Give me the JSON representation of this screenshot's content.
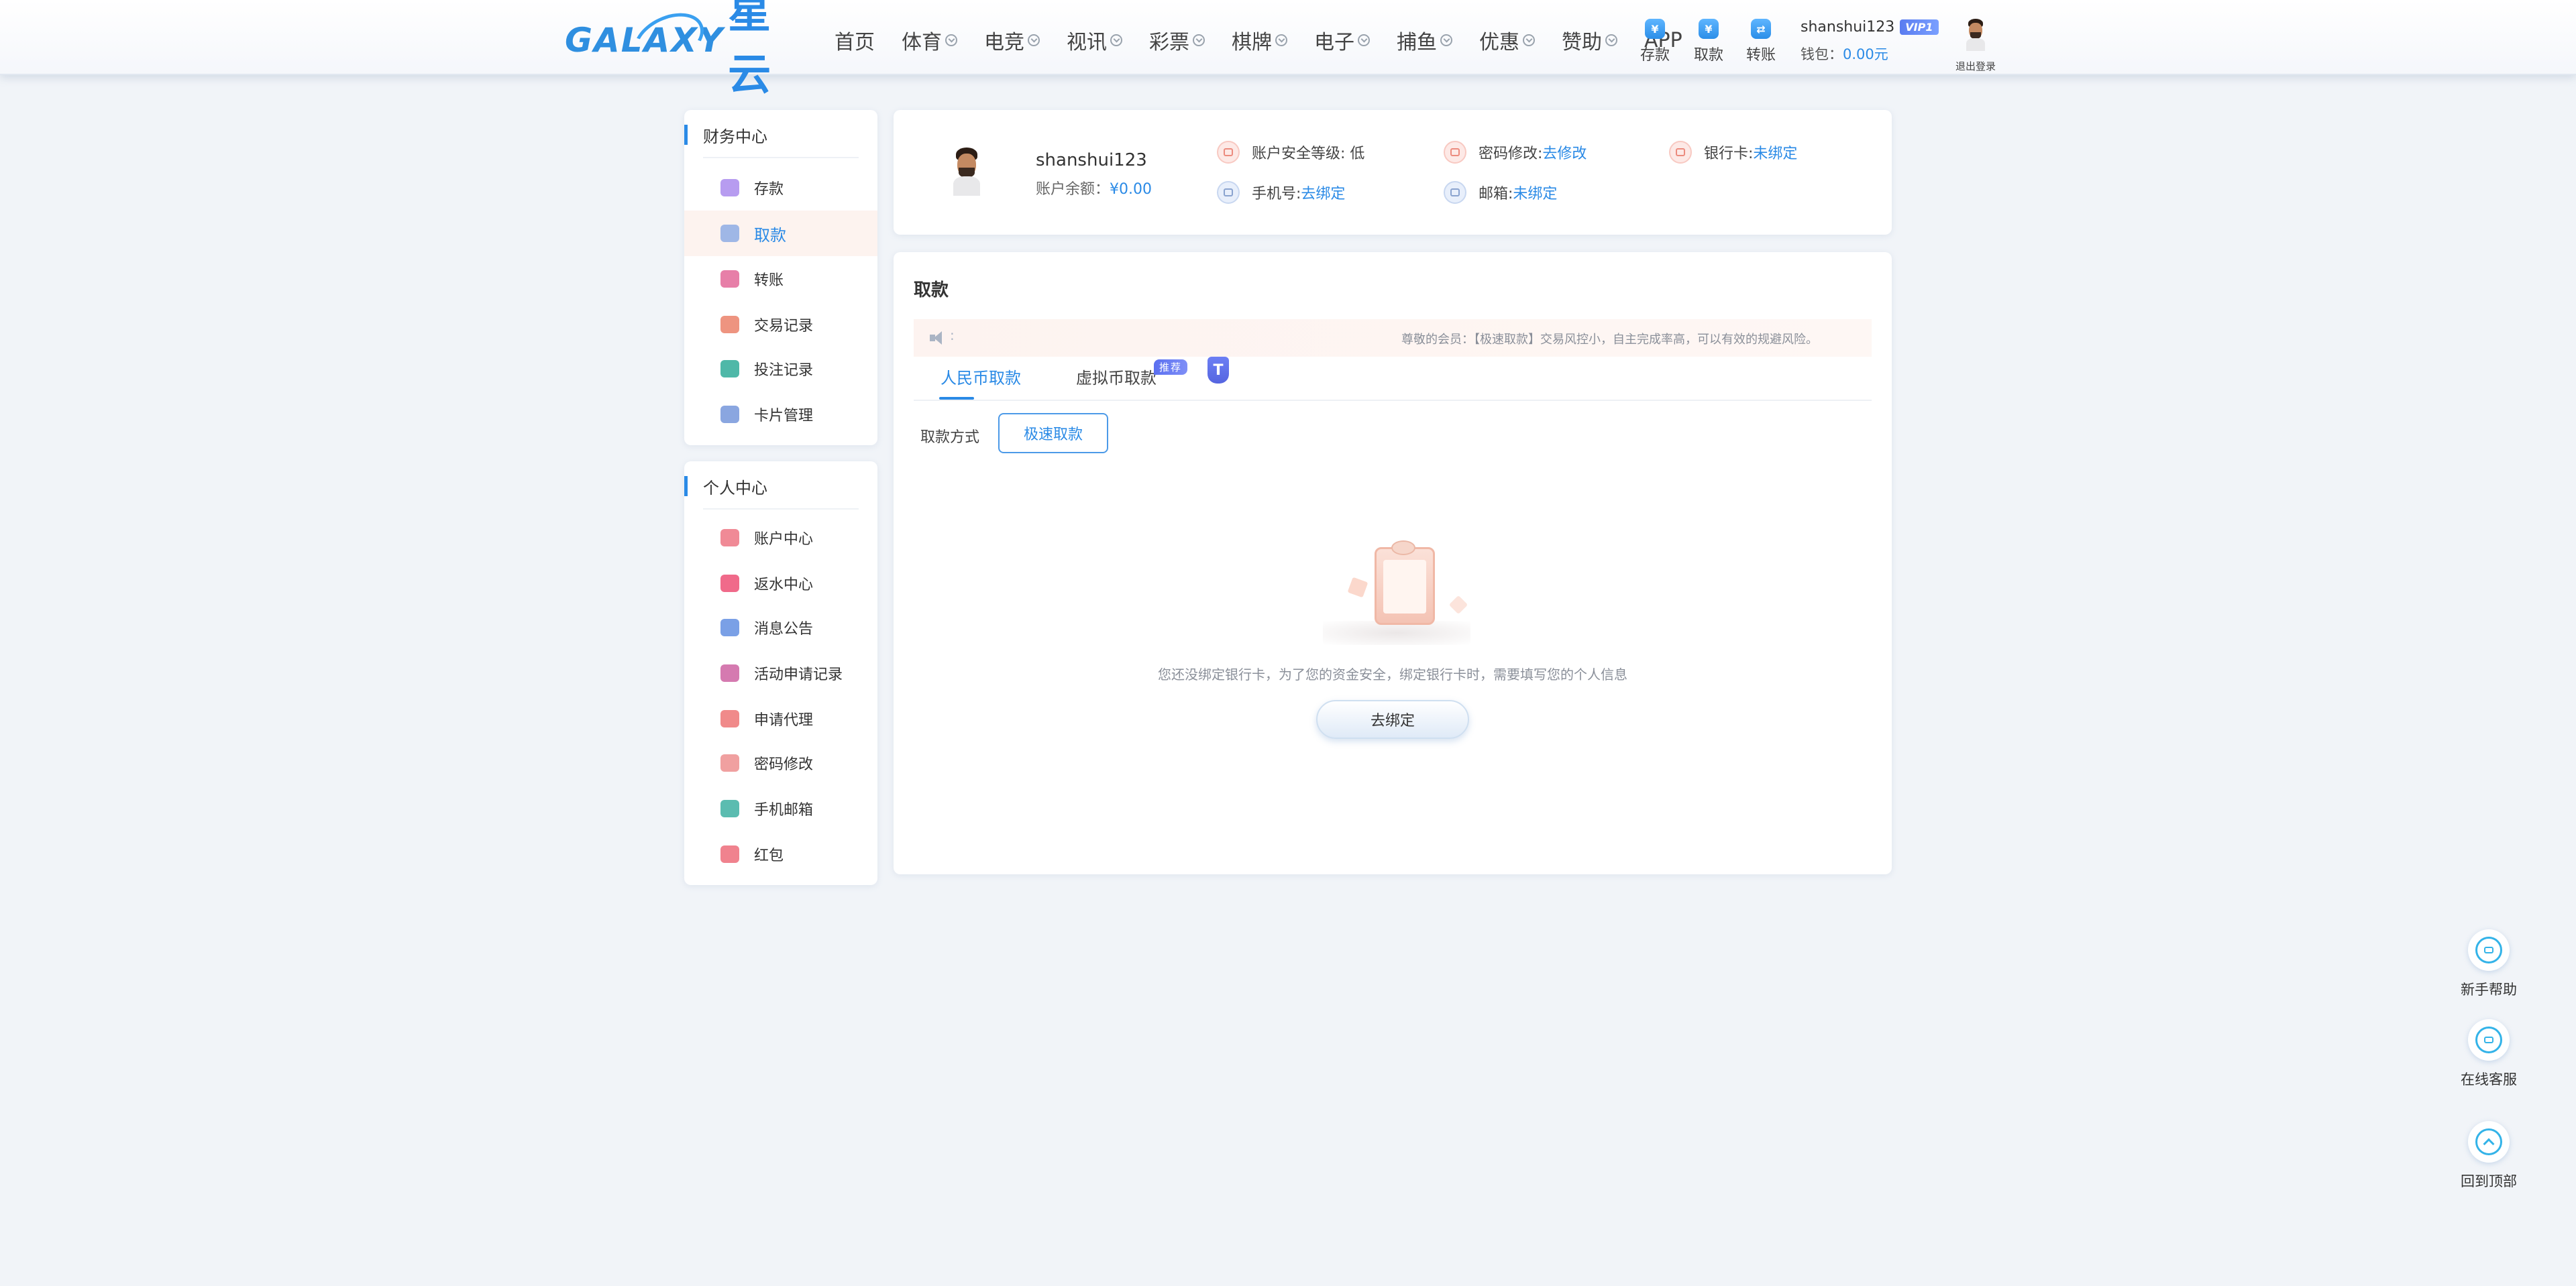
{
  "header": {
    "logo_text": "GALAXY",
    "logo_cn": "星云",
    "nav": [
      {
        "label": "首页",
        "dropdown": false
      },
      {
        "label": "体育",
        "dropdown": true
      },
      {
        "label": "电竞",
        "dropdown": true
      },
      {
        "label": "视讯",
        "dropdown": true
      },
      {
        "label": "彩票",
        "dropdown": true
      },
      {
        "label": "棋牌",
        "dropdown": true
      },
      {
        "label": "电子",
        "dropdown": true
      },
      {
        "label": "捕鱼",
        "dropdown": true
      },
      {
        "label": "优惠",
        "dropdown": true
      },
      {
        "label": "赞助",
        "dropdown": true
      },
      {
        "label": "APP",
        "dropdown": false
      }
    ],
    "quick_actions": [
      {
        "label": "存款",
        "icon": "deposit-icon"
      },
      {
        "label": "取款",
        "icon": "withdraw-icon"
      },
      {
        "label": "转账",
        "icon": "transfer-icon"
      }
    ],
    "username": "shanshui123",
    "vip": "VIP1",
    "wallet_label": "钱包：",
    "wallet_value": "0.00元",
    "logout_label": "退出登录"
  },
  "sidebar": {
    "finance": {
      "title": "财务中心",
      "items": [
        {
          "label": "存款",
          "icon": "deposit-icon",
          "color": "#b79cf0",
          "active": false
        },
        {
          "label": "取款",
          "icon": "wallet-icon",
          "color": "#9fb7e6",
          "active": true
        },
        {
          "label": "转账",
          "icon": "transfer-icon",
          "color": "#e77fa8",
          "active": false
        },
        {
          "label": "交易记录",
          "icon": "transaction-record-icon",
          "color": "#ee9480",
          "active": false
        },
        {
          "label": "投注记录",
          "icon": "bet-record-icon",
          "color": "#4fb8a8",
          "active": false
        },
        {
          "label": "卡片管理",
          "icon": "card-icon",
          "color": "#8aa6e0",
          "active": false
        }
      ]
    },
    "personal": {
      "title": "个人中心",
      "items": [
        {
          "label": "账户中心",
          "icon": "heart-icon",
          "color": "#f08a96"
        },
        {
          "label": "返水中心",
          "icon": "gift-icon",
          "color": "#f06a8a"
        },
        {
          "label": "消息公告",
          "icon": "bell-icon",
          "color": "#7aa0e6"
        },
        {
          "label": "活动申请记录",
          "icon": "user-card-icon",
          "color": "#d57ab0"
        },
        {
          "label": "申请代理",
          "icon": "agent-icon",
          "color": "#f08a8a"
        },
        {
          "label": "密码修改",
          "icon": "lock-icon",
          "color": "#f0a0a0"
        },
        {
          "label": "手机邮箱",
          "icon": "mail-icon",
          "color": "#5bbcb0"
        },
        {
          "label": "红包",
          "icon": "red-envelope-icon",
          "color": "#f0828e"
        }
      ]
    }
  },
  "profile": {
    "username": "shanshui123",
    "balance_label": "账户余额：",
    "balance_value": "¥0.00",
    "security_label": "账户安全等级: 低",
    "password_label": "密码修改: ",
    "password_link": "去修改",
    "bankcard_label": "银行卡: ",
    "bankcard_link": "未绑定",
    "phone_label": "手机号: ",
    "phone_link": "去绑定",
    "email_label": "邮箱: ",
    "email_link": "未绑定"
  },
  "main": {
    "title": "取款",
    "notice": "尊敬的会员：【极速取款】交易风控小，自主完成率高，可以有效的规避风险。",
    "tabs": [
      {
        "label": "人民币取款",
        "active": true
      },
      {
        "label": "虚拟币取款",
        "active": false
      }
    ],
    "recommend_badge": "推荐",
    "recommend_t": "T",
    "method_label": "取款方式",
    "method_button": "极速取款",
    "empty_text": "您还没绑定银行卡，为了您的资金安全，绑定银行卡时，需要填写您的个人信息",
    "bind_button": "去绑定"
  },
  "float_buttons": [
    {
      "label": "新手帮助",
      "icon": "help-icon"
    },
    {
      "label": "在线客服",
      "icon": "headset-icon"
    },
    {
      "label": "回到顶部",
      "icon": "back-to-top-icon"
    }
  ],
  "colors": {
    "accent": "#2a8ae6",
    "page_bg": "#f1f4f8"
  }
}
